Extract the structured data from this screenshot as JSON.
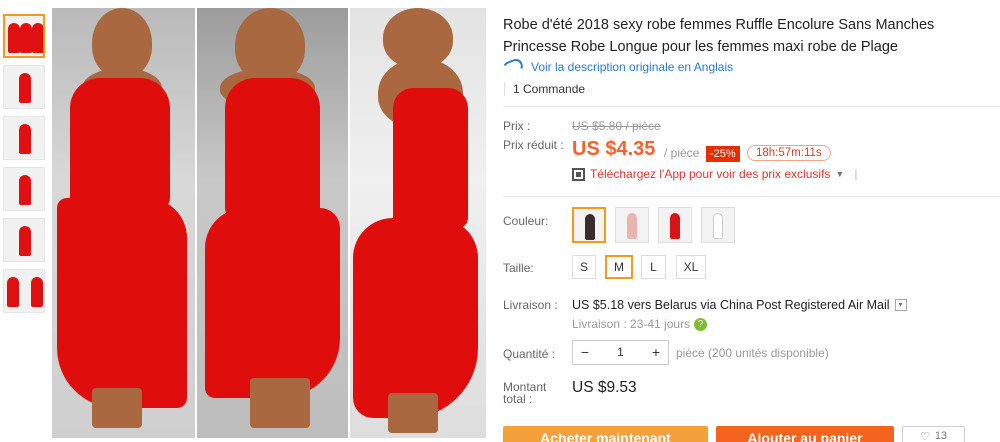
{
  "product": {
    "title": "Robe d'été 2018 sexy robe femmes Ruffle Encolure Sans Manches Princesse Robe Longue pour les femmes maxi robe de Plage",
    "translate_link": "Voir la description originale en Anglais",
    "orders": "1 Commande"
  },
  "pricing": {
    "price_label": "Prix :",
    "old_price": "US $5.80 / pièce",
    "sale_label": "Prix réduit :",
    "sale_price": "US $4.35",
    "unit": "/ pièce",
    "discount": "-25%",
    "countdown": "18h:57m:11s",
    "app_promo": "Téléchargez l'App pour voir des prix exclusifs"
  },
  "colors": {
    "label": "Couleur:",
    "swatches": [
      {
        "name": "black-red",
        "hex": "#3a2c2c"
      },
      {
        "name": "pink",
        "hex": "#e8b5b0"
      },
      {
        "name": "red",
        "hex": "#d91414"
      },
      {
        "name": "white",
        "hex": "#ececec"
      }
    ],
    "selected_index": 0
  },
  "sizes": {
    "label": "Taille:",
    "options": [
      "S",
      "M",
      "L",
      "XL"
    ],
    "selected": "M"
  },
  "shipping": {
    "label": "Livraison :",
    "method": "US $5.18 vers Belarus via China Post Registered Air Mail",
    "delivery_time": "Livraison : 23-41 jours"
  },
  "quantity": {
    "label": "Quantité :",
    "minus": "−",
    "value": "1",
    "plus": "+",
    "availability": "pièce (200 unités disponible)"
  },
  "total": {
    "label": "Montant total :",
    "value": "US $9.53"
  },
  "buttons": {
    "buy_now": "Acheter maintenant",
    "add_to_cart": "Ajouter au panier",
    "wishlist_count": "13"
  },
  "thumbnails_count": 6
}
